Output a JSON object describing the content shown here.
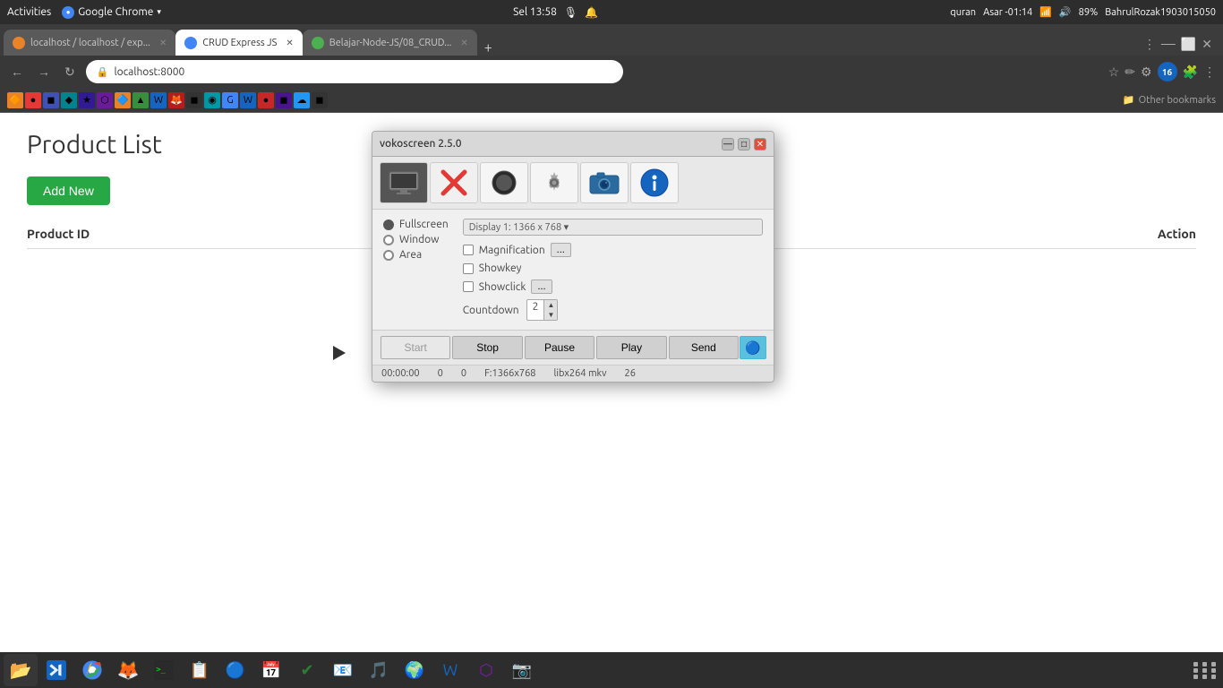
{
  "system_bar": {
    "activities": "Activities",
    "browser_name": "Google Chrome",
    "time": "Sel 13:58",
    "prayer": "quran",
    "user": "Asar -01:14",
    "battery": "89%",
    "profile": "BahrulRozak1903015050"
  },
  "browser": {
    "tabs": [
      {
        "id": "tab1",
        "favicon_color": "#e8832a",
        "title": "localhost / localhost / exp...",
        "active": false
      },
      {
        "id": "tab2",
        "favicon_color": "#4285f4",
        "title": "CRUD Express JS",
        "active": true
      },
      {
        "id": "tab3",
        "favicon_color": "#4caf50",
        "title": "Belajar-Node-JS/08_CRUD...",
        "active": false
      }
    ],
    "url": "localhost:8000",
    "profile_number": "16"
  },
  "page": {
    "title": "Product List",
    "add_button": "Add New",
    "table": {
      "col_id": "Product ID",
      "col_action": "Action"
    }
  },
  "vokoscreen": {
    "title": "vokoscreen 2.5.0",
    "toolbar": {
      "screen_icon": "🖥",
      "stop_icon": "✕",
      "record_label": "●",
      "settings_label": "⚙",
      "camera_label": "📷",
      "info_label": "ℹ"
    },
    "capture_mode": {
      "fullscreen": "Fullscreen",
      "window": "Window",
      "area": "Area",
      "display": "Display 1:  1366 x 768 ▾"
    },
    "options": {
      "magnification": "Magnification",
      "showkey": "Showkey",
      "showclick": "Showclick",
      "more_btn": "..."
    },
    "countdown": {
      "label": "Countdown",
      "value": "2"
    },
    "buttons": {
      "start": "Start",
      "stop": "Stop",
      "pause": "Pause",
      "play": "Play",
      "send": "Send"
    },
    "status": {
      "time": "00:00:00",
      "val1": "0",
      "val2": "0",
      "resolution": "F:1366x768",
      "codec": "libx264  mkv",
      "num": "26"
    }
  },
  "taskbar": {
    "items": [
      {
        "icon": "🗂",
        "color": "#e8832a",
        "name": "files"
      },
      {
        "icon": "💻",
        "color": "#2196f3",
        "name": "vscode"
      },
      {
        "icon": "🌐",
        "color": "#4285f4",
        "name": "chrome"
      },
      {
        "icon": "🦊",
        "color": "#e8832a",
        "name": "firefox"
      },
      {
        "icon": "🖥",
        "color": "#333",
        "name": "terminal"
      },
      {
        "icon": "📂",
        "color": "#e8832a",
        "name": "filemanager"
      },
      {
        "icon": "📋",
        "color": "#c62828",
        "name": "clipboard"
      },
      {
        "icon": "🔵",
        "color": "#1565c0",
        "name": "app1"
      },
      {
        "icon": "📅",
        "color": "#1976d2",
        "name": "calendar"
      },
      {
        "icon": "✔",
        "color": "#2e7d32",
        "name": "check"
      },
      {
        "icon": "📧",
        "color": "#1976d2",
        "name": "email"
      },
      {
        "icon": "🎵",
        "color": "#1db954",
        "name": "music"
      },
      {
        "icon": "🌍",
        "color": "#2196f3",
        "name": "browser2"
      },
      {
        "icon": "W",
        "color": "#1565c0",
        "name": "word"
      },
      {
        "icon": "⬡",
        "color": "#7b1fa2",
        "name": "app2"
      },
      {
        "icon": "📷",
        "color": "#333",
        "name": "camera"
      }
    ]
  }
}
